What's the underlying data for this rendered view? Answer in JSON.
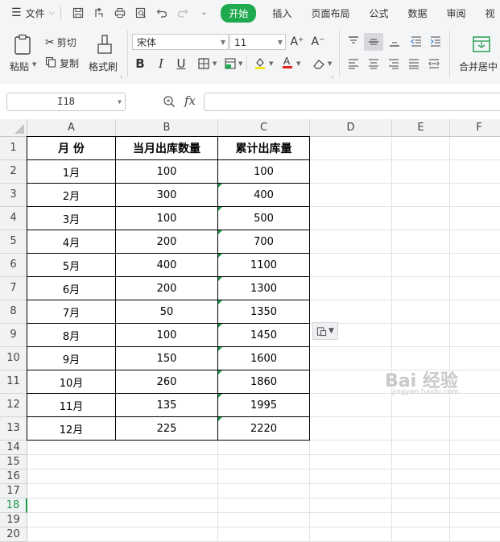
{
  "menubar": {
    "file_label": "文件",
    "tabs": [
      {
        "label": "开始",
        "active": true
      },
      {
        "label": "插入",
        "active": false
      },
      {
        "label": "页面布局",
        "active": false
      },
      {
        "label": "公式",
        "active": false
      },
      {
        "label": "数据",
        "active": false
      },
      {
        "label": "审阅",
        "active": false
      },
      {
        "label": "视",
        "active": false
      }
    ]
  },
  "ribbon": {
    "paste_label": "粘贴",
    "cut_label": "剪切",
    "copy_label": "复制",
    "format_painter_label": "格式刷",
    "font_name": "宋体",
    "font_size": "11",
    "grow_font": "A⁺",
    "shrink_font": "A⁻",
    "bold": "B",
    "italic": "I",
    "underline": "U",
    "merge_center_label": "合并居中"
  },
  "formula_bar": {
    "name_box": "I18",
    "fx_label": "fx",
    "formula_value": ""
  },
  "sheet": {
    "columns": [
      "A",
      "B",
      "C",
      "D",
      "E",
      "F"
    ],
    "rows": [
      "1",
      "2",
      "3",
      "4",
      "5",
      "6",
      "7",
      "8",
      "9",
      "10",
      "11",
      "12",
      "13",
      "14",
      "15",
      "16",
      "17",
      "18",
      "19",
      "20"
    ],
    "selected_row": "18",
    "header": [
      "月  份",
      "当月出库数量",
      "累计出库量"
    ],
    "data": [
      [
        "1月",
        "100",
        "100"
      ],
      [
        "2月",
        "300",
        "400"
      ],
      [
        "3月",
        "100",
        "500"
      ],
      [
        "4月",
        "200",
        "700"
      ],
      [
        "5月",
        "400",
        "1100"
      ],
      [
        "6月",
        "200",
        "1300"
      ],
      [
        "7月",
        "50",
        "1350"
      ],
      [
        "8月",
        "100",
        "1450"
      ],
      [
        "9月",
        "150",
        "1600"
      ],
      [
        "10月",
        "260",
        "1860"
      ],
      [
        "11月",
        "135",
        "1995"
      ],
      [
        "12月",
        "225",
        "2220"
      ]
    ]
  },
  "watermark": {
    "logo": "Bai 经验",
    "url": "jingyan.baidu.com"
  },
  "colors": {
    "accent": "#1faa4f",
    "error_triangle": "#1a9a49"
  }
}
